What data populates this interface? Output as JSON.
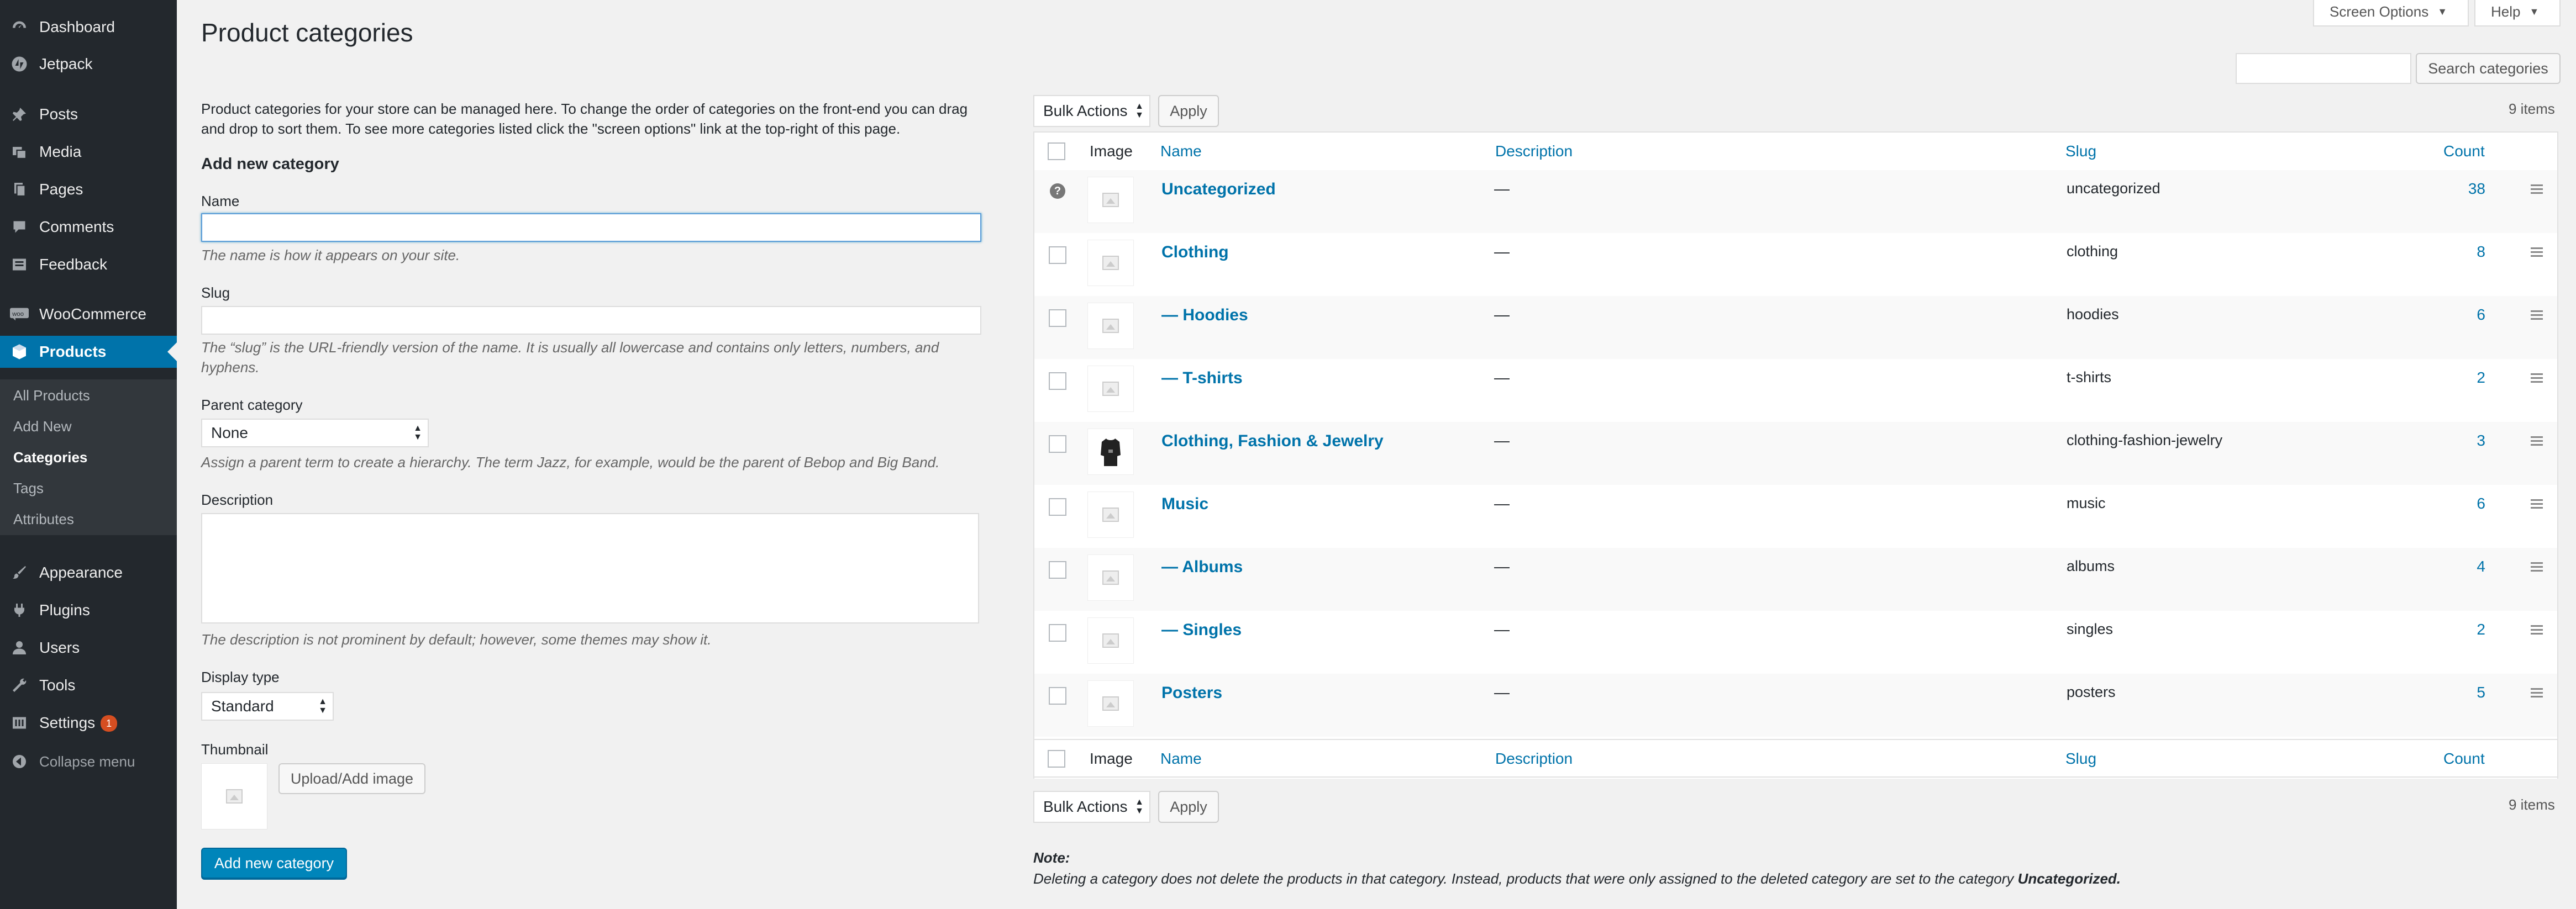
{
  "sidebar": {
    "items": [
      {
        "label": "Dashboard",
        "icon": "dashboard-icon"
      },
      {
        "label": "Jetpack",
        "icon": "jetpack-icon"
      },
      {
        "label": "Posts",
        "icon": "pin-icon"
      },
      {
        "label": "Media",
        "icon": "media-icon"
      },
      {
        "label": "Pages",
        "icon": "pages-icon"
      },
      {
        "label": "Comments",
        "icon": "comment-icon"
      },
      {
        "label": "Feedback",
        "icon": "feedback-icon"
      },
      {
        "label": "WooCommerce",
        "icon": "woocommerce-icon"
      },
      {
        "label": "Products",
        "icon": "products-icon"
      },
      {
        "label": "Appearance",
        "icon": "brush-icon"
      },
      {
        "label": "Plugins",
        "icon": "plugin-icon"
      },
      {
        "label": "Users",
        "icon": "users-icon"
      },
      {
        "label": "Tools",
        "icon": "tools-icon"
      },
      {
        "label": "Settings",
        "icon": "settings-icon",
        "badge": "1"
      },
      {
        "label": "Collapse menu",
        "icon": "collapse-icon"
      }
    ],
    "submenu": [
      "All Products",
      "Add New",
      "Categories",
      "Tags",
      "Attributes"
    ]
  },
  "top": {
    "screen_options": "Screen Options",
    "help": "Help"
  },
  "page_title": "Product categories",
  "intro": {
    "line1": "Product categories for your store can be managed here. To change the order of categories on the front-end you can drag",
    "line2": "and drop to sort them. To see more categories listed click the \"screen options\" link at the top-right of this page."
  },
  "form": {
    "heading": "Add new category",
    "name_label": "Name",
    "name_desc": "The name is how it appears on your site.",
    "slug_label": "Slug",
    "slug_desc1": "The “slug” is the URL-friendly version of the name. It is usually all lowercase and contains only letters, numbers, and",
    "slug_desc2": "hyphens.",
    "parent_label": "Parent category",
    "parent_value": "None",
    "parent_desc": "Assign a parent term to create a hierarchy. The term Jazz, for example, would be the parent of Bebop and Big Band.",
    "description_label": "Description",
    "description_desc": "The description is not prominent by default; however, some themes may show it.",
    "display_label": "Display type",
    "display_value": "Standard",
    "thumbnail_label": "Thumbnail",
    "upload_button": "Upload/Add image",
    "submit_button": "Add new category"
  },
  "search": {
    "button": "Search categories"
  },
  "bulk": {
    "label": "Bulk Actions",
    "apply": "Apply",
    "items_count": "9 items"
  },
  "table": {
    "headers": {
      "image": "Image",
      "name": "Name",
      "description": "Description",
      "slug": "Slug",
      "count": "Count"
    },
    "rows": [
      {
        "name": "Uncategorized",
        "description": "—",
        "slug": "uncategorized",
        "count": "38"
      },
      {
        "name": "Clothing",
        "description": "—",
        "slug": "clothing",
        "count": "8"
      },
      {
        "name": "— Hoodies",
        "description": "—",
        "slug": "hoodies",
        "count": "6"
      },
      {
        "name": "— T-shirts",
        "description": "—",
        "slug": "t-shirts",
        "count": "2"
      },
      {
        "name": "Clothing, Fashion & Jewelry",
        "description": "—",
        "slug": "clothing-fashion-jewelry",
        "count": "3"
      },
      {
        "name": "Music",
        "description": "—",
        "slug": "music",
        "count": "6"
      },
      {
        "name": "— Albums",
        "description": "—",
        "slug": "albums",
        "count": "4"
      },
      {
        "name": "— Singles",
        "description": "—",
        "slug": "singles",
        "count": "2"
      },
      {
        "name": "Posters",
        "description": "—",
        "slug": "posters",
        "count": "5"
      }
    ]
  },
  "note": {
    "label": "Note:",
    "text": "Deleting a category does not delete the products in that category. Instead, products that were only assigned to the deleted category are set to the category",
    "emph": "Uncategorized."
  },
  "colors": {
    "sidebar_bg": "#23282d",
    "accent": "#0073aa",
    "primary_button": "#0085ba",
    "badge": "#d54e21"
  }
}
